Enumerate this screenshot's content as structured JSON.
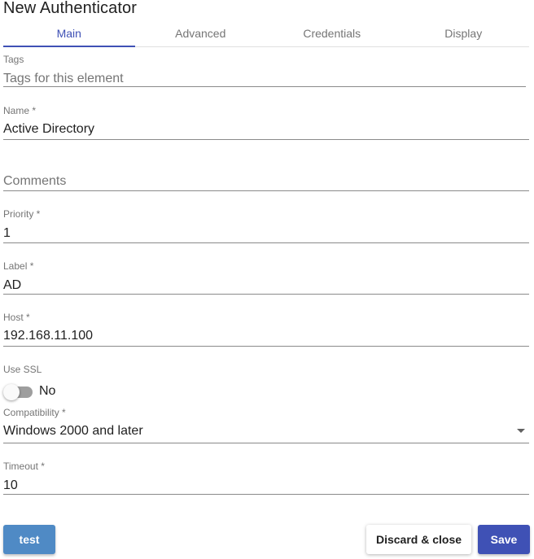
{
  "dialog": {
    "title": "New Authenticator"
  },
  "tabs": [
    {
      "label": "Main",
      "active": true
    },
    {
      "label": "Advanced",
      "active": false
    },
    {
      "label": "Credentials",
      "active": false
    },
    {
      "label": "Display",
      "active": false
    }
  ],
  "fields": {
    "tags": {
      "label": "Tags",
      "placeholder": "Tags for this element",
      "value": ""
    },
    "name": {
      "label": "Name *",
      "value": "Active Directory"
    },
    "comments": {
      "label": "",
      "placeholder": "Comments",
      "value": ""
    },
    "priority": {
      "label": "Priority *",
      "value": "1"
    },
    "label": {
      "label": "Label *",
      "value": "AD"
    },
    "host": {
      "label": "Host *",
      "value": "192.168.11.100"
    },
    "use_ssl": {
      "label": "Use SSL",
      "state_text": "No",
      "checked": false
    },
    "compatibility": {
      "label": "Compatibility *",
      "value": "Windows 2000 and later"
    },
    "timeout": {
      "label": "Timeout *",
      "value": "10"
    }
  },
  "buttons": {
    "test": "test",
    "discard": "Discard & close",
    "save": "Save"
  },
  "colors": {
    "accent": "#3f51b5",
    "test_button": "#4f8ac5",
    "save_button": "#3f51b5"
  },
  "icons": {
    "compatibility_dropdown": "chevron-down-icon"
  }
}
